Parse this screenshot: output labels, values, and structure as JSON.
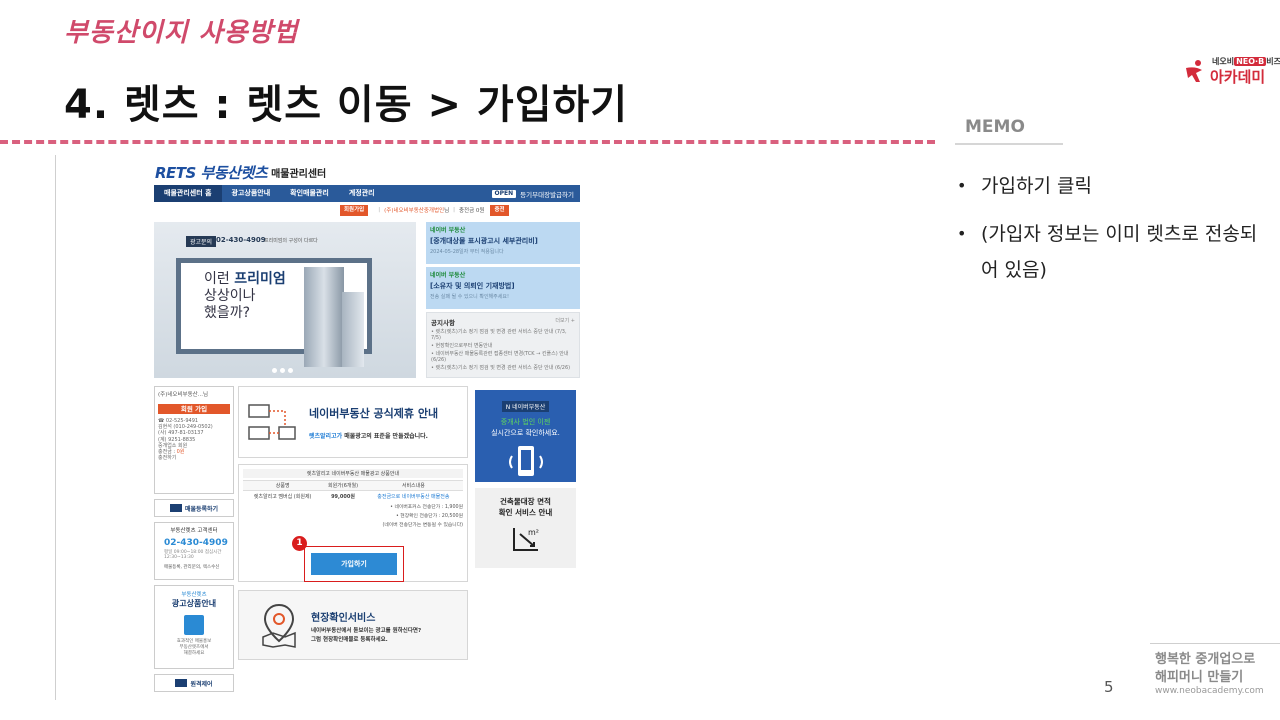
{
  "slide": {
    "subtitle": "부동산이지 사용방법",
    "title": "4. 렛츠 : 렛츠 이동 > 가입하기",
    "accent_color": "#d04a6b",
    "logo": {
      "top": "네오비",
      "badge": "NEO·B",
      "top_suffix": "비즈",
      "main": "아카데미",
      "icon": "running-figure-icon"
    },
    "memo_label": "MEMO",
    "memo_items": [
      "가입하기 클릭",
      "(가입자 정보는 이미 렛츠로 전송되어 있음)"
    ],
    "page_number": "5",
    "footer_line1": "행복한 중개업으로",
    "footer_line2": "해피머니 만들기",
    "footer_url": "www.neobacademy.com"
  },
  "screenshot": {
    "logo_text": "RETS 부동산렛츠",
    "logo_suffix": "매물관리센터",
    "nav": [
      "매물관리센터 홈",
      "광고상품안내",
      "확인매물관리",
      "계정관리"
    ],
    "nav_open": "OPEN",
    "nav_register": "등기부대장발급하기",
    "userbar": {
      "join": "회원가입",
      "company": "(주)네오비부동산중개법인",
      "suffix": "님",
      "balance": "충전금 0원",
      "charge": "충전"
    },
    "banner": {
      "call": "광고문의",
      "phone": "02-430-4909",
      "desc": "프리미엄의 구성이 다르다",
      "line1_pre": "이런 ",
      "line1_bold": "프리미엄",
      "line2": "상상이나",
      "line3": "했을까?"
    },
    "news": [
      {
        "name": "네이버 부동산",
        "head": "[중개대상물 표시광고시 세부관리비]",
        "sub": "2024-05-28일자 부터 적용됩니다"
      },
      {
        "name": "네이버 부동산",
        "head": "[소유자 및 의뢰인 기재방법]",
        "sub": "전송 실패 될 수 있으니 확인해주세요!"
      }
    ],
    "notice": {
      "title": "공지사항",
      "more": "더보기 +",
      "items": [
        "• 렛츠(렛츠)기소 정기 점검 및 변경 관련 서비스 중단 안내 (7/3, 7/5)",
        "• 현장확인으로부터 변동안내",
        "• 네이버부동산 매물등록관련 접종센터 변경(TCK → 킨플스) 안내 (6/26)",
        "• 렛츠(렛츠)기소 정기 점검 및 변경 관련 서비스 중단 안내 (6/26)"
      ]
    },
    "left": {
      "user": "(주)네오비부동산...님",
      "join": "회원 가입",
      "info": [
        "☎ 02-525-9491",
        "김현석 (010-249-0502)",
        "(사) 497-81-03137",
        "(계) 9251-8835",
        "중개업소 회원"
      ],
      "balance_label": "충전금 : ",
      "balance_value": "0원",
      "charge": "충전하기",
      "property_button": "매물등록하기",
      "cs_title": "부동산렛츠 고객센터",
      "cs_phone": "02-430-4909",
      "cs_hours": "평일 09:00~18:00 점심시간 12:30~13:30",
      "cs_note": "매물등록, 관리문의, 렉스수신",
      "ad_title": "부동산렛츠",
      "ad_main_1": "광고상품",
      "ad_main_2": "안내",
      "ad_text": [
        "효과적인 매물홍보",
        "부동산렛츠에서",
        "해결하세요"
      ],
      "remote": "원격제어"
    },
    "center": {
      "naver_title": "네이버부동산 공식제휴 안내",
      "naver_sub_pre": "렛츠알리고가",
      "naver_sub_post": " 매물광고의 표준을 만들겠습니다.",
      "product_header": "렛츠알리고 네이버부동산 매물광고 상품안내",
      "columns": [
        "상품명",
        "회원가(6개월)",
        "서비스내용"
      ],
      "row": [
        "렛츠알리고 멤버십 (회원제)",
        "99,000원",
        "충전금으로 네이버부동산 매물전송"
      ],
      "notes": [
        "• 네이버포커스 전송단가 : 1,900원",
        "• 현장확인 전송단가 : 20,500원",
        "(네이버 전송단가는 변동될 수 있습니다)"
      ],
      "step": "1",
      "join_button": "가입하기",
      "site_title": "현장확인서비스",
      "site_line1": "네이버부동산에서 돋보이는 광고를 원하신다면?",
      "site_line2": "그럼 현장확인매물로 등록하세요."
    },
    "right": {
      "naver_badge": "N 네이버부동산",
      "naver_line1_green": "중개사 법인",
      "naver_line1_post": "이젠",
      "naver_line2": "실시간으로 확인하세요.",
      "building_line1": "건축물대장 면적",
      "building_line2": "확인 서비스 안내"
    }
  }
}
